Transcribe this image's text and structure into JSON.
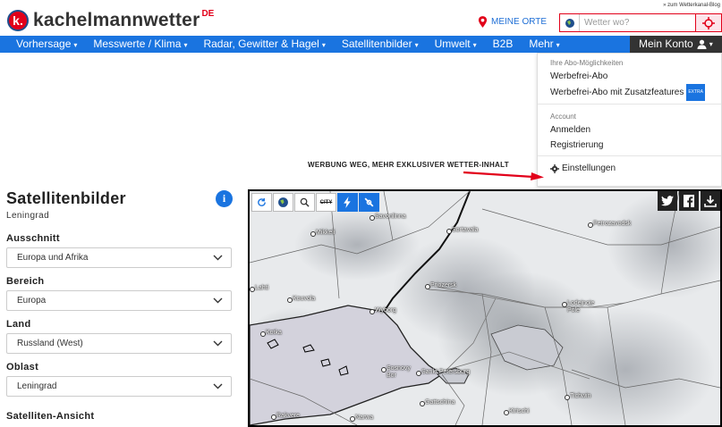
{
  "header": {
    "logo_text": "kachelmannwetter",
    "logo_suffix": "DE",
    "logo_badge": "k.",
    "top_link": "» zum Wetterkanal-Blog",
    "meine_orte": "MEINE ORTE",
    "search": {
      "placeholder": "Wetter wo?"
    }
  },
  "nav": {
    "items": [
      {
        "label": "Vorhersage",
        "caret": "▾"
      },
      {
        "label": "Messwerte / Klima",
        "caret": "▾"
      },
      {
        "label": "Radar, Gewitter & Hagel",
        "caret": "▾"
      },
      {
        "label": "Satellitenbilder",
        "caret": "▾"
      },
      {
        "label": "Umwelt",
        "caret": "▾"
      },
      {
        "label": "B2B",
        "caret": ""
      },
      {
        "label": "Mehr",
        "caret": "▾"
      }
    ],
    "account": {
      "label": "Mein Konto",
      "caret": "▾"
    }
  },
  "account_menu": {
    "section_abo": "Ihre Abo-Möglichkeiten",
    "werbefrei": "Werbefrei-Abo",
    "werbefrei_plus": "Werbefrei-Abo mit Zusatzfeatures",
    "extra_badge": "EXTRA",
    "section_account": "Account",
    "anmelden": "Anmelden",
    "registrierung": "Registrierung",
    "einstellungen": "Einstellungen"
  },
  "ad_banner": "WERBUNG WEG, MEHR EXKLUSIVER WETTER-INHALT",
  "sidebar": {
    "title": "Satellitenbilder",
    "subtitle": "Leningrad",
    "info_symbol": "i",
    "fields": [
      {
        "label": "Ausschnitt",
        "value": "Europa und Afrika"
      },
      {
        "label": "Bereich",
        "value": "Europa"
      },
      {
        "label": "Land",
        "value": "Russland (West)"
      },
      {
        "label": "Oblast",
        "value": "Leningrad"
      }
    ],
    "next_section": "Satelliten-Ansicht"
  },
  "map": {
    "tools": [
      {
        "icon": "refresh-icon",
        "active": false
      },
      {
        "icon": "globe-icon",
        "active": false
      },
      {
        "icon": "zoom-icon",
        "active": false
      },
      {
        "icon": "city-toggle-icon",
        "label": "CITY",
        "active": false
      },
      {
        "icon": "lightning-icon",
        "active": true
      },
      {
        "icon": "satellite-icon",
        "active": true
      }
    ],
    "social": [
      "twitter-icon",
      "facebook-icon",
      "download-icon"
    ],
    "cities": [
      "Savonlinna",
      "Mikkeli",
      "Sortavala",
      "Petrozavodsk",
      "Lahti",
      "Kouvola",
      "Priozersk",
      "Lodejnoje Pole",
      "Kotka",
      "Wyborg",
      "Sosnovy Bor",
      "Sankt Petersburg",
      "Tichwin",
      "Gattschina",
      "Rakvere",
      "Narwa",
      "Kirischi"
    ]
  },
  "colors": {
    "brand_blue": "#1a74e0",
    "brand_red": "#e2001a",
    "account_bg": "#333333"
  }
}
